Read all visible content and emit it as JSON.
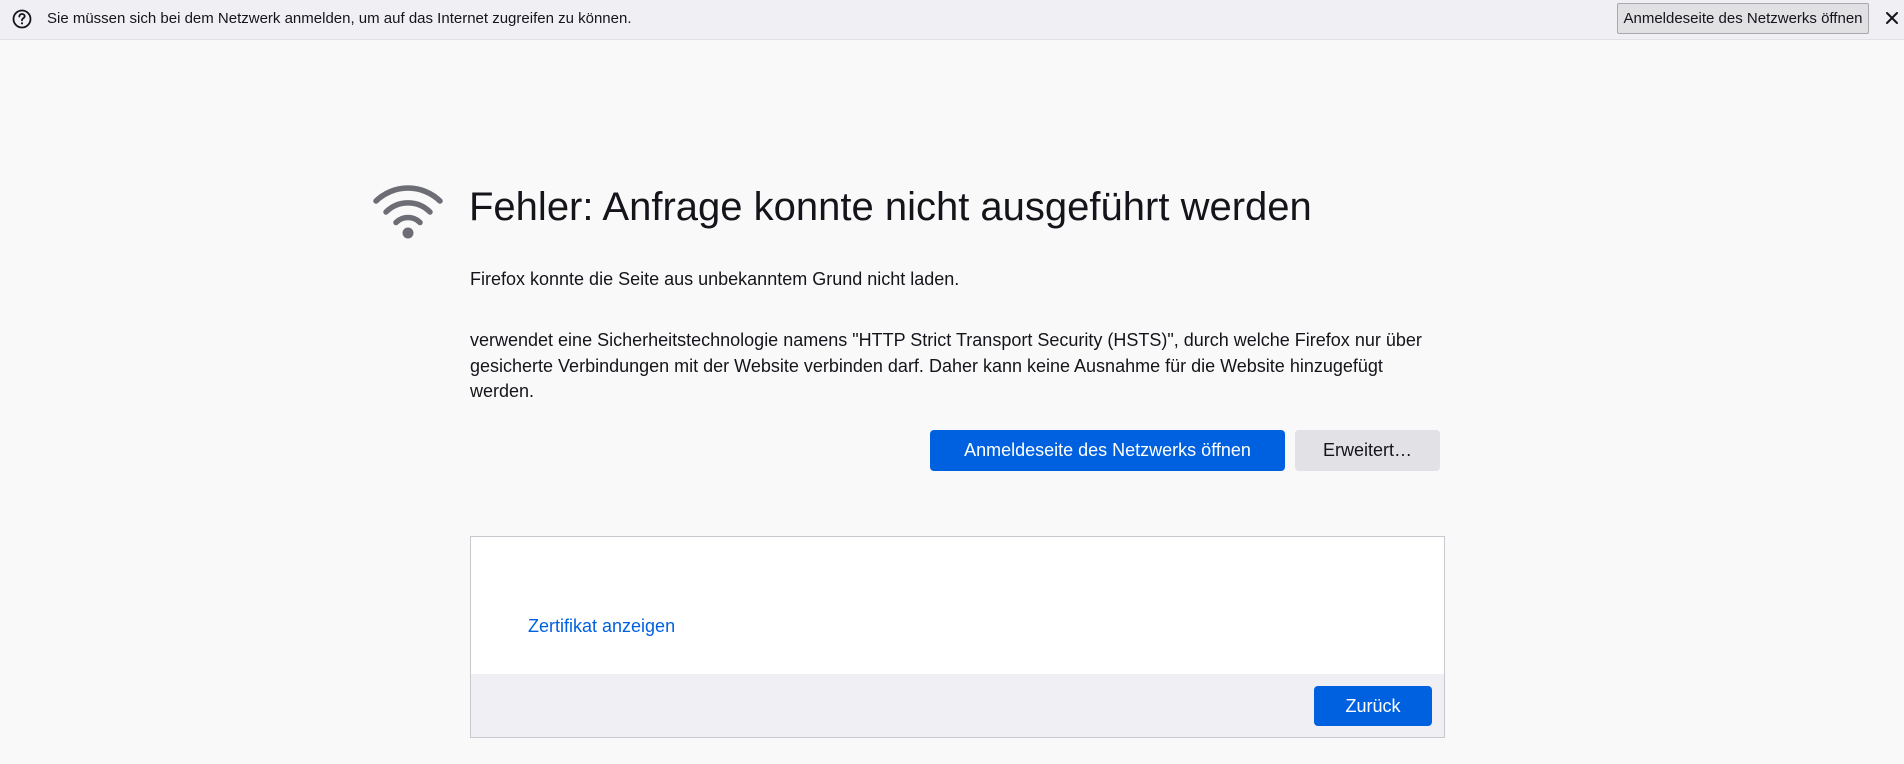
{
  "notification_bar": {
    "icon": "question-circle-icon",
    "message": "Sie müssen sich bei dem Netzwerk anmelden, um auf das Internet zugreifen zu können.",
    "button_label": "Anmeldeseite des Netzwerks öffnen",
    "close_icon": "close-icon"
  },
  "error_page": {
    "icon": "wifi-icon",
    "title": "Fehler: Anfrage konnte nicht ausgeführt werden",
    "description": "Firefox konnte die Seite aus unbekanntem Grund nicht laden.",
    "hsts_text": "verwendet eine Sicherheitstechnologie namens \"HTTP Strict Transport Security (HSTS)\", durch welche Firefox nur über gesicherte Verbindungen mit der Website verbinden darf. Daher kann keine Ausnahme für die Website hinzugefügt werden.",
    "primary_button": "Anmeldeseite des Netzwerks öffnen",
    "advanced_button": "Erweitert…",
    "advanced_panel": {
      "certificate_link": "Zertifikat anzeigen",
      "back_button": "Zurück"
    }
  },
  "colors": {
    "accent": "#0061e0",
    "background": "#f9f9fa",
    "notification_bar": "#f0f0f4",
    "icon_gray": "#6d6d75"
  }
}
